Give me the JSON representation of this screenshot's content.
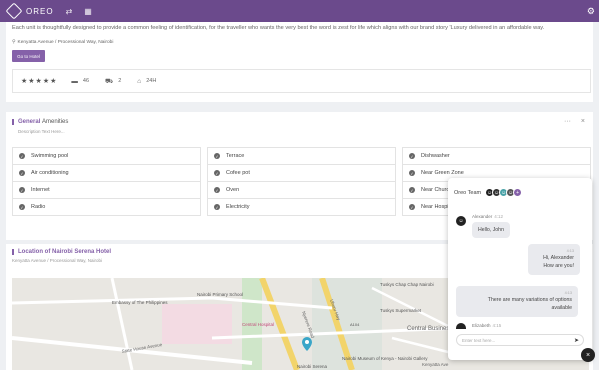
{
  "topbar": {
    "brand": "OREO",
    "icon1": "⇄",
    "icon2": "▦",
    "settings_icon": "⚙"
  },
  "hotel": {
    "description": "Each unit is thoughtfully designed to provide a common feeling of identification, for the traveller who wants the very best the word is zest for life which aligns with our brand story 'Luxury delivered in an affordable way.",
    "address": "Kenyatta Avenue / Processional Way, Nairobi",
    "button": "Go to Hotel",
    "stars": "★★★★★",
    "stats": [
      {
        "icon": "▬",
        "value": "46"
      },
      {
        "icon": "⛟",
        "value": "2"
      },
      {
        "icon": "⌂",
        "value": "24H"
      }
    ]
  },
  "amenities": {
    "title_hl": "General",
    "title_rest": "Amenities",
    "subtitle": "Description Text Here...",
    "menu_icon": "···",
    "close_icon": "×",
    "columns": [
      [
        "Swimming pool",
        "Air conditioning",
        "Internet",
        "Radio"
      ],
      [
        "Terrace",
        "Cofee pot",
        "Oven",
        "Electricity"
      ],
      [
        "Dishwasher",
        "Near Green Zone",
        "Near Church",
        "Near Hospital"
      ]
    ]
  },
  "location": {
    "title": "Location of Nairobi Serena Hotel",
    "subtitle": "Kenyatta Avenue / Processional Way, Nairobi"
  },
  "map_labels": [
    {
      "text": "Embassy of The Philippines"
    },
    {
      "text": "Nairobi Primary School"
    },
    {
      "text": "Central Hospital"
    },
    {
      "text": "Tuskys Chap Chap Nairobi"
    },
    {
      "text": "Tuskys Supermarket"
    },
    {
      "text": "Central Business District"
    },
    {
      "text": "Nairobi Museum of Kenya - Nairobi Gallery"
    },
    {
      "text": "Nairobi Serena"
    },
    {
      "text": "State House Avenue"
    },
    {
      "text": "Nyerere Road"
    },
    {
      "text": "Uhuru Hwy"
    },
    {
      "text": "A104"
    },
    {
      "text": "Kenyatta Ave"
    }
  ],
  "chat": {
    "title": "Oreo Team",
    "messages": [
      {
        "name": "Alexander",
        "time": "4:12",
        "text": "Hello, John"
      },
      {
        "time": "4:13",
        "lines": [
          "Hi, Alexander",
          "How are you!"
        ]
      },
      {
        "time": "4:13",
        "lines": [
          "There are many variations of options",
          "available"
        ]
      },
      {
        "name": "Elizabeth",
        "time": "4:15"
      }
    ],
    "input_placeholder": "Enter text here...",
    "send_icon": "➤",
    "close_icon": "×"
  }
}
